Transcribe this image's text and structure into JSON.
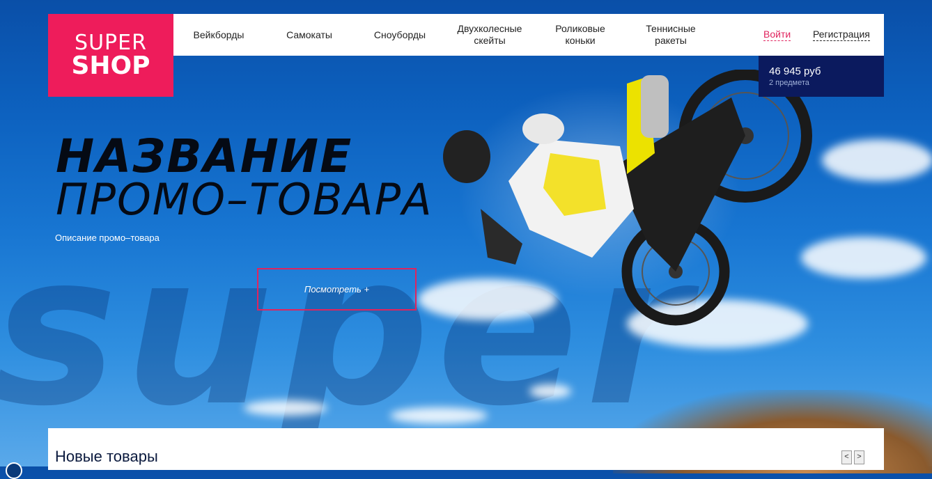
{
  "logo": {
    "line1": "SUPER",
    "line2": "SHOP"
  },
  "nav": [
    {
      "label": "Вейкборды"
    },
    {
      "label": "Самокаты"
    },
    {
      "label": "Сноуборды"
    },
    {
      "label": "Двухколесные скейты"
    },
    {
      "label": "Роликовые коньки"
    },
    {
      "label": "Теннисные ракеты"
    }
  ],
  "auth": {
    "login": "Войти",
    "register": "Регистрация"
  },
  "cart": {
    "price": "46 945 руб",
    "count": "2 предмета"
  },
  "promo": {
    "title_line1": "НАЗВАНИЕ",
    "title_line2": "ПРОМО–ТОВАРА",
    "description": "Описание промо–товара",
    "button": "Посмотреть +"
  },
  "new_products": {
    "title": "Новые товары",
    "prev": "<",
    "next": ">"
  },
  "colors": {
    "accent": "#ee1c5b",
    "cart_bg": "#0b1a5e",
    "login": "#e0245e"
  }
}
